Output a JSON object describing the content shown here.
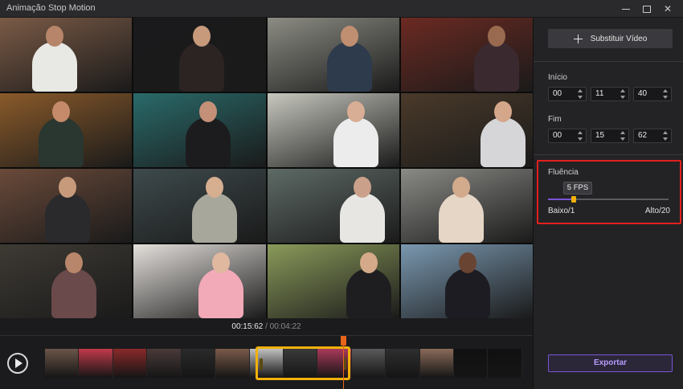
{
  "window": {
    "title": "Animação Stop Motion"
  },
  "preview": {
    "tiles": [
      {
        "bg": "#7a5a46",
        "person": "#e8e8e4",
        "head": "#b7866a"
      },
      {
        "bg": "#1a1a1c",
        "person": "#2b2422",
        "head": "#c79a7c"
      },
      {
        "bg": "#8c8c84",
        "person": "#2d3b4c",
        "head": "#c08e70"
      },
      {
        "bg": "#6b2a22",
        "person": "#3a2a30",
        "head": "#9a6a50"
      },
      {
        "bg": "#8a5a2a",
        "person": "#2a3630",
        "head": "#c48a6a"
      },
      {
        "bg": "#2a6a6a",
        "person": "#1c1c1e",
        "head": "#c49078"
      },
      {
        "bg": "#c8c8c0",
        "person": "#ececec",
        "head": "#d8ae94"
      },
      {
        "bg": "#4a3a2a",
        "person": "#d6d6d8",
        "head": "#d4a68a"
      },
      {
        "bg": "#6a4a3a",
        "person": "#2a2a2c",
        "head": "#c89a7c"
      },
      {
        "bg": "#3e4a4c",
        "person": "#a7a79c",
        "head": "#d6ae90"
      },
      {
        "bg": "#5e6a66",
        "person": "#e8e6e2",
        "head": "#caa08a"
      },
      {
        "bg": "#8a8a86",
        "person": "#e6d6c6",
        "head": "#d2aa8c"
      },
      {
        "bg": "#3e3a34",
        "person": "#6a4a4a",
        "head": "#b8866a"
      },
      {
        "bg": "#e4e0dc",
        "person": "#f2a9b8",
        "head": "#e0b8a0"
      },
      {
        "bg": "#8a9a5a",
        "person": "#1e1e20",
        "head": "#d4aa8a"
      },
      {
        "bg": "#7a98b0",
        "person": "#1c1c22",
        "head": "#6a4432"
      }
    ]
  },
  "time": {
    "current": "00:15:62",
    "separator": "/",
    "total": "00:04:22"
  },
  "timeline": {
    "frames": [
      "#6a5548",
      "#c03a4a",
      "#8a2a2a",
      "#4a3a3a",
      "#2a2a2a",
      "#7a5a4a",
      "#c0c0c0",
      "#3a3a3a",
      "#a83a5a",
      "#5a5a5a",
      "#2e2e2e",
      "#8a6a5a",
      "#101010",
      "#101010"
    ],
    "playhead_fraction": 0.627
  },
  "panel": {
    "replace_label": "Substituir Vídeo",
    "start_label": "Início",
    "start": {
      "h": "00",
      "m": "11",
      "s": "40"
    },
    "end_label": "Fim",
    "end": {
      "h": "00",
      "m": "15",
      "s": "62"
    },
    "fluency": {
      "label": "Fluência",
      "value_text": "5 FPS",
      "value": 5,
      "min": 1,
      "max": 20,
      "min_label": "Baixo/1",
      "max_label": "Alto/20",
      "accent": "#7a54d6",
      "highlight": "#e2201d"
    },
    "export_label": "Exportar"
  }
}
